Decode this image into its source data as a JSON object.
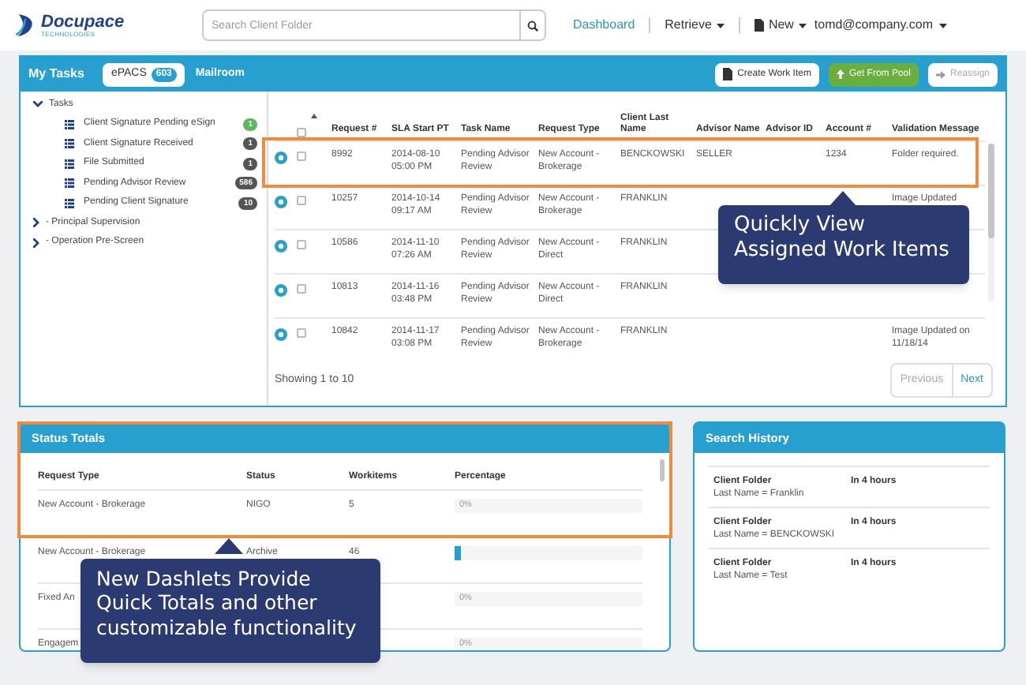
{
  "header": {
    "logo": {
      "name": "Docupace",
      "tagline": "TECHNOLOGIES"
    },
    "search": {
      "placeholder": "Search Client Folder"
    },
    "nav": [
      {
        "label": "Dashboard",
        "selected": true,
        "dropdown": false,
        "icon": false
      },
      {
        "label": "Retrieve",
        "selected": false,
        "dropdown": true,
        "icon": false
      },
      {
        "label": "New",
        "selected": false,
        "dropdown": true,
        "icon": true
      }
    ],
    "user": "tomd@company.com"
  },
  "tasks_panel": {
    "title": "My Tasks",
    "tabs": [
      {
        "label": "ePACS",
        "badge": "603",
        "selected": true
      },
      {
        "label": "Mailroom",
        "selected": false
      }
    ],
    "actions": [
      {
        "label": "Create Work Item",
        "kind": "default",
        "disabled": false
      },
      {
        "label": "Get From Pool",
        "kind": "success",
        "disabled": false
      },
      {
        "label": "Reassign",
        "kind": "default",
        "disabled": true
      }
    ],
    "tree": [
      {
        "label": "Tasks",
        "expanded": true,
        "children": [
          {
            "label": "Client Signature Pending eSign",
            "count": "1",
            "color": "#5cb85c"
          },
          {
            "label": "Client Signature Received",
            "count": "1",
            "color": "#555555"
          },
          {
            "label": "File Submitted",
            "count": "1",
            "color": "#555555"
          },
          {
            "label": "Pending Advisor Review",
            "count": "586",
            "color": "#555555"
          },
          {
            "label": "Pending Client Signature",
            "count": "10",
            "color": "#555555"
          }
        ]
      },
      {
        "label": "- Principal Supervision",
        "expanded": false
      },
      {
        "label": "- Operation Pre-Screen",
        "expanded": false
      }
    ],
    "table": {
      "all_selected": false,
      "columns": [
        "Request #",
        "SLA Start PT",
        "Task Name",
        "Request Type",
        "Client Last Name",
        "Advisor Name",
        "Advisor ID",
        "Account #",
        "Validation Message"
      ],
      "rows": [
        {
          "selected": false,
          "cells": [
            "8992",
            "2014-08-10 05:00 PM",
            "Pending Advisor Review",
            "New Account - Brokerage",
            "BENCKOWSKI",
            "SELLER",
            "",
            "1234",
            "Folder required."
          ]
        },
        {
          "selected": false,
          "cells": [
            "10257",
            "2014-10-14 09:17 AM",
            "Pending Advisor Review",
            "New Account - Brokerage",
            "FRANKLIN",
            "",
            "",
            "",
            "Image Updated"
          ]
        },
        {
          "selected": false,
          "cells": [
            "10586",
            "2014-11-10 07:26 AM",
            "Pending Advisor Review",
            "New Account - Direct",
            "FRANKLIN",
            "",
            "",
            "",
            ""
          ]
        },
        {
          "selected": false,
          "cells": [
            "10813",
            "2014-11-16 03:48 PM",
            "Pending Advisor Review",
            "New Account - Direct",
            "FRANKLIN",
            "",
            "",
            "",
            ""
          ]
        },
        {
          "selected": false,
          "cells": [
            "10842",
            "2014-11-17 03:08 PM",
            "Pending Advisor Review",
            "New Account - Brokerage",
            "FRANKLIN",
            "",
            "",
            "",
            "Image Updated on 11/18/14"
          ]
        }
      ]
    },
    "showing": "Showing 1 to 10",
    "pagination": [
      {
        "label": "Previous",
        "disabled": true
      },
      {
        "label": "Next",
        "disabled": false
      }
    ]
  },
  "status_totals": {
    "title": "Status Totals",
    "columns": [
      "Request Type",
      "Status",
      "Workitems",
      "Percentage"
    ],
    "rows": [
      {
        "request_type": "New Account - Brokerage",
        "status": "NIGO",
        "workitems": "5",
        "level": 0,
        "percentage": "0%"
      },
      {
        "request_type": "New Account - Brokerage",
        "status": "Archive",
        "workitems": "46",
        "level": 0.03
      },
      {
        "request_type": "Fixed An",
        "status": "",
        "workitems": "",
        "level": 0,
        "percentage": "0%"
      },
      {
        "request_type": "Engagem",
        "status": "",
        "workitems": "",
        "level": 0,
        "percentage": "0%"
      }
    ]
  },
  "search_history": {
    "title": "Search History",
    "items": [
      {
        "title": "Client Folder",
        "detail": "Last Name = Franklin",
        "time": "In 4 hours"
      },
      {
        "title": "Client Folder",
        "detail": "Last Name = BENCKOWSKI",
        "time": "In 4 hours"
      },
      {
        "title": "Client Folder",
        "detail": "Last Name = Test",
        "time": "In 4 hours"
      }
    ]
  },
  "callouts": [
    {
      "text": "Quickly View\nAssigned Work Items"
    },
    {
      "text": "New Dashlets Provide\nQuick Totals and other\ncustomizable functionality"
    }
  ]
}
